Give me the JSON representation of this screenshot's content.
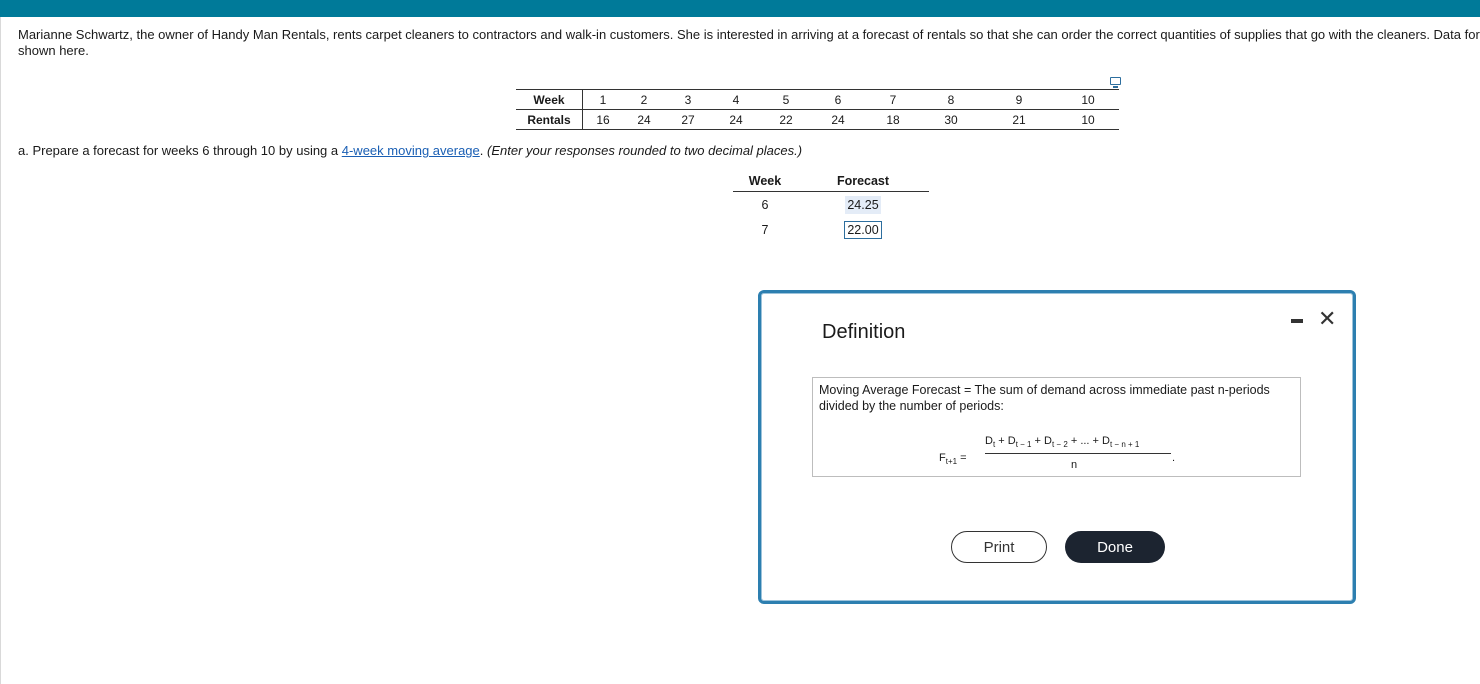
{
  "intro": {
    "line1": "Marianne Schwartz, the owner of Handy Man Rentals, rents carpet cleaners to contractors and walk-in customers. She is interested in arriving at a forecast of rentals so that she can order the correct quantities of supplies that go with the cleaners. Data for",
    "line2": "shown here."
  },
  "data_table": {
    "row_labels": [
      "Week",
      "Rentals"
    ],
    "weeks": [
      "1",
      "2",
      "3",
      "4",
      "5",
      "6",
      "7",
      "8",
      "9",
      "10"
    ],
    "rentals": [
      "16",
      "24",
      "27",
      "24",
      "22",
      "24",
      "18",
      "30",
      "21",
      "10"
    ]
  },
  "question": {
    "prefix": "a. Prepare a forecast for weeks 6 through 10 by using a ",
    "link": "4-week moving average",
    "suffix": ". ",
    "instruction": "(Enter your responses rounded to two decimal places.)"
  },
  "forecast_table": {
    "headers": [
      "Week",
      "Forecast"
    ],
    "rows": [
      {
        "week": "6",
        "forecast": "24.25"
      },
      {
        "week": "7",
        "forecast": "22.00"
      }
    ]
  },
  "modal": {
    "title": "Definition",
    "definition": "Moving Average Forecast = The sum of demand across immediate past n-periods divided by the number of periods:",
    "formula": {
      "lhs": "F",
      "lhs_sub": "t+1",
      "equals": "=",
      "numerator_terms": [
        {
          "var": "D",
          "sub": "t"
        },
        {
          "sep": " + "
        },
        {
          "var": "D",
          "sub": "t − 1"
        },
        {
          "sep": " + "
        },
        {
          "var": "D",
          "sub": "t − 2"
        },
        {
          "sep": " + ... + "
        },
        {
          "var": "D",
          "sub": "t − n + 1"
        }
      ],
      "denominator": "n",
      "period": "."
    },
    "buttons": {
      "print": "Print",
      "done": "Done"
    },
    "close_symbol": "✕"
  },
  "colors": {
    "topbar": "#007a99",
    "modal_border": "#2d7fb0",
    "link": "#1a5fb4",
    "done_button": "#1c2430"
  }
}
